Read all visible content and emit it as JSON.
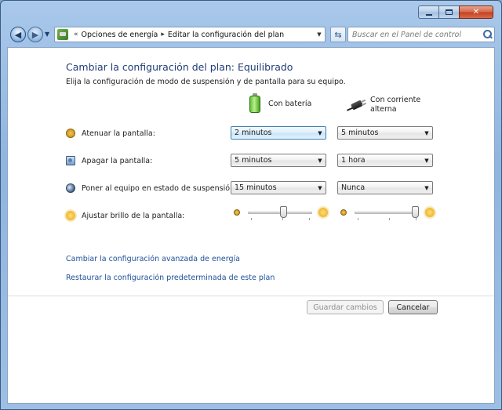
{
  "nav": {
    "back_icon": "back-arrow-icon",
    "forward_icon": "forward-arrow-icon",
    "breadcrumb": [
      "Opciones de energía",
      "Editar la configuración del plan"
    ],
    "breadcrumb_prefix": "«",
    "breadcrumb_separator": "▸",
    "search_placeholder": "Buscar en el Panel de control"
  },
  "page": {
    "title": "Cambiar la configuración del plan: Equilibrado",
    "subtitle": "Elija la configuración de modo de suspensión y de pantalla para su equipo."
  },
  "columns": {
    "battery": "Con batería",
    "ac_line1": "Con corriente",
    "ac_line2": "alterna"
  },
  "settings": [
    {
      "icon": "dim-display-icon",
      "label": "Atenuar la pantalla:",
      "battery": "2 minutos",
      "ac": "5 minutos"
    },
    {
      "icon": "display-off-icon",
      "label": "Apagar la pantalla:",
      "battery": "5 minutos",
      "ac": "1 hora"
    },
    {
      "icon": "sleep-icon",
      "label": "Poner al equipo en estado de suspensión:",
      "battery": "15 minutos",
      "ac": "Nunca"
    }
  ],
  "brightness": {
    "icon": "brightness-icon",
    "label": "Ajustar brillo de la pantalla:",
    "battery_level": 0.55,
    "ac_level": 0.95
  },
  "links": {
    "advanced": "Cambiar la configuración avanzada de energía",
    "restore": "Restaurar la configuración predeterminada de este plan"
  },
  "buttons": {
    "save": "Guardar cambios",
    "cancel": "Cancelar"
  },
  "colors": {
    "title": "#1e3d78",
    "link": "#1e4f99"
  }
}
